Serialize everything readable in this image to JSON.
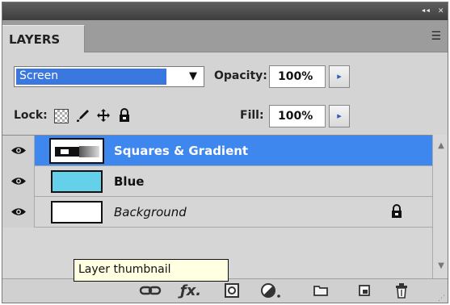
{
  "panel": {
    "title_controls": {
      "collapse": "◂◂",
      "close": "✕"
    },
    "tab_label": "LAYERS",
    "menu_icon": "☰"
  },
  "blend": {
    "mode": "Screen",
    "arrow": "▼",
    "opacity_label": "Opacity:",
    "opacity_value": "100%",
    "stepper": "▸"
  },
  "lock": {
    "label": "Lock:",
    "fill_label": "Fill:",
    "fill_value": "100%",
    "stepper": "▸",
    "icons": [
      "lock-transparent-icon",
      "lock-image-icon",
      "lock-position-icon",
      "lock-all-icon"
    ]
  },
  "layers": [
    {
      "name": "Squares & Gradient",
      "selected": true,
      "visible": true,
      "thumbnail": "squares-gradient"
    },
    {
      "name": "Blue",
      "selected": false,
      "visible": true,
      "thumbnail": "#64d0ea"
    },
    {
      "name": "Background",
      "selected": false,
      "visible": true,
      "italic": true,
      "locked": true,
      "thumbnail": "#ffffff"
    }
  ],
  "tooltip": "Layer thumbnail",
  "bottom_icons": [
    "link-icon",
    "fx-icon",
    "mask-icon",
    "adjustment-icon",
    "folder-icon",
    "new-layer-icon",
    "trash-icon"
  ],
  "colors": {
    "selection": "#3d87ee",
    "blend_highlight": "#3a78e0",
    "panel": "#d4d4d4",
    "tooltip_bg": "#ffffe1"
  }
}
